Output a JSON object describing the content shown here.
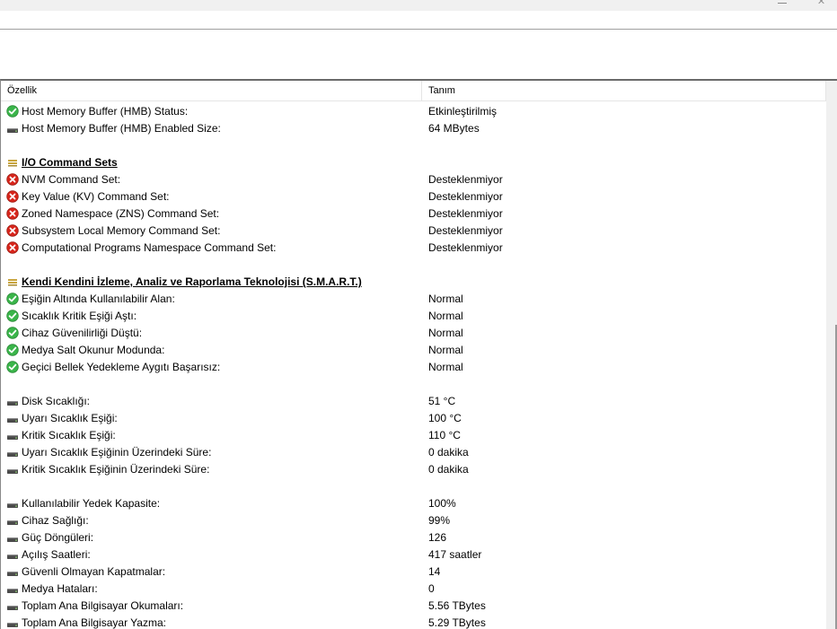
{
  "columns": {
    "property": "Özellik",
    "description": "Tanım"
  },
  "rows": [
    {
      "icon": "check-icon",
      "label": "Host Memory Buffer (HMB) Status:",
      "value": "Etkinleştirilmiş"
    },
    {
      "icon": "drive-icon",
      "label": "Host Memory Buffer (HMB) Enabled Size:",
      "value": "64 MBytes"
    },
    {
      "icon": "none",
      "label": "",
      "value": ""
    },
    {
      "icon": "section-icon",
      "label": "I/O Command Sets",
      "value": "",
      "section": true
    },
    {
      "icon": "error-icon",
      "label": "NVM Command Set:",
      "value": "Desteklenmiyor"
    },
    {
      "icon": "error-icon",
      "label": "Key Value (KV) Command Set:",
      "value": "Desteklenmiyor"
    },
    {
      "icon": "error-icon",
      "label": "Zoned Namespace (ZNS) Command Set:",
      "value": "Desteklenmiyor"
    },
    {
      "icon": "error-icon",
      "label": "Subsystem Local Memory Command Set:",
      "value": "Desteklenmiyor"
    },
    {
      "icon": "error-icon",
      "label": "Computational Programs Namespace Command Set:",
      "value": "Desteklenmiyor"
    },
    {
      "icon": "none",
      "label": "",
      "value": ""
    },
    {
      "icon": "section-icon",
      "label": "Kendi Kendini İzleme, Analiz ve Raporlama Teknolojisi (S.M.A.R.T.)",
      "value": "",
      "section": true
    },
    {
      "icon": "check-icon",
      "label": "Eşiğin Altında Kullanılabilir Alan:",
      "value": "Normal"
    },
    {
      "icon": "check-icon",
      "label": "Sıcaklık Kritik Eşiği Aştı:",
      "value": "Normal"
    },
    {
      "icon": "check-icon",
      "label": "Cihaz Güvenilirliği Düştü:",
      "value": "Normal"
    },
    {
      "icon": "check-icon",
      "label": "Medya Salt Okunur Modunda:",
      "value": "Normal"
    },
    {
      "icon": "check-icon",
      "label": "Geçici Bellek Yedekleme Aygıtı Başarısız:",
      "value": "Normal"
    },
    {
      "icon": "none",
      "label": "",
      "value": ""
    },
    {
      "icon": "drive-icon",
      "label": "Disk Sıcaklığı:",
      "value": "51 °C"
    },
    {
      "icon": "drive-icon",
      "label": "Uyarı Sıcaklık Eşiği:",
      "value": "100 °C"
    },
    {
      "icon": "drive-icon",
      "label": "Kritik Sıcaklık Eşiği:",
      "value": "110 °C"
    },
    {
      "icon": "drive-icon",
      "label": "Uyarı Sıcaklık Eşiğinin Üzerindeki Süre:",
      "value": "0 dakika"
    },
    {
      "icon": "drive-icon",
      "label": "Kritik Sıcaklık Eşiğinin Üzerindeki Süre:",
      "value": "0 dakika"
    },
    {
      "icon": "none",
      "label": "",
      "value": ""
    },
    {
      "icon": "drive-icon",
      "label": "Kullanılabilir Yedek Kapasite:",
      "value": "100%"
    },
    {
      "icon": "drive-icon",
      "label": "Cihaz Sağlığı:",
      "value": "99%"
    },
    {
      "icon": "drive-icon",
      "label": "Güç Döngüleri:",
      "value": "126"
    },
    {
      "icon": "drive-icon",
      "label": "Açılış Saatleri:",
      "value": "417 saatler"
    },
    {
      "icon": "drive-icon",
      "label": "Güvenli Olmayan Kapatmalar:",
      "value": "14"
    },
    {
      "icon": "drive-icon",
      "label": "Medya Hataları:",
      "value": "0"
    },
    {
      "icon": "drive-icon",
      "label": "Toplam Ana Bilgisayar Okumaları:",
      "value": "5.56 TBytes"
    },
    {
      "icon": "drive-icon",
      "label": "Toplam Ana Bilgisayar Yazma:",
      "value": "5.29 TBytes"
    }
  ],
  "colors": {
    "check": "#3ab54a",
    "error": "#d8261c",
    "drive": "#4a4a4a",
    "section": "#c9a640"
  }
}
